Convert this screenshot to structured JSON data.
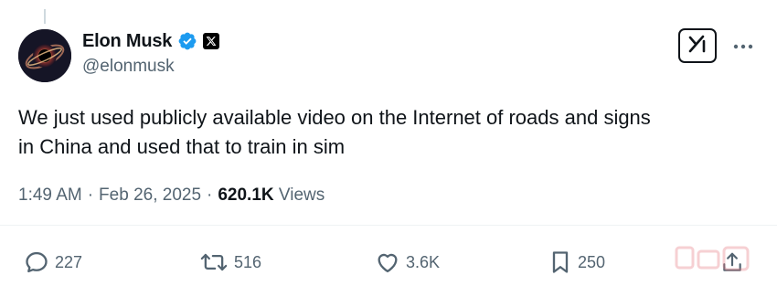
{
  "author": {
    "display_name": "Elon Musk",
    "handle": "@elonmusk",
    "verified": true,
    "affiliation_badge": "x-logo-icon"
  },
  "header_actions": {
    "grok_icon": "grok-icon",
    "more_icon": "more-icon"
  },
  "tweet": {
    "text": "We just used publicly available video on the Internet of roads and signs\nin China and used that to train in sim"
  },
  "meta": {
    "time": "1:49 AM",
    "separator": "·",
    "date": "Feb 26, 2025",
    "separator2": "·",
    "views_count": "620.1K",
    "views_label": "Views"
  },
  "actions": {
    "reply_count": "227",
    "repost_count": "516",
    "like_count": "3.6K",
    "bookmark_count": "250"
  },
  "colors": {
    "text_primary": "#0f1419",
    "text_secondary": "#536471",
    "verified_blue": "#1d9bf0",
    "divider": "#eff3f4"
  }
}
